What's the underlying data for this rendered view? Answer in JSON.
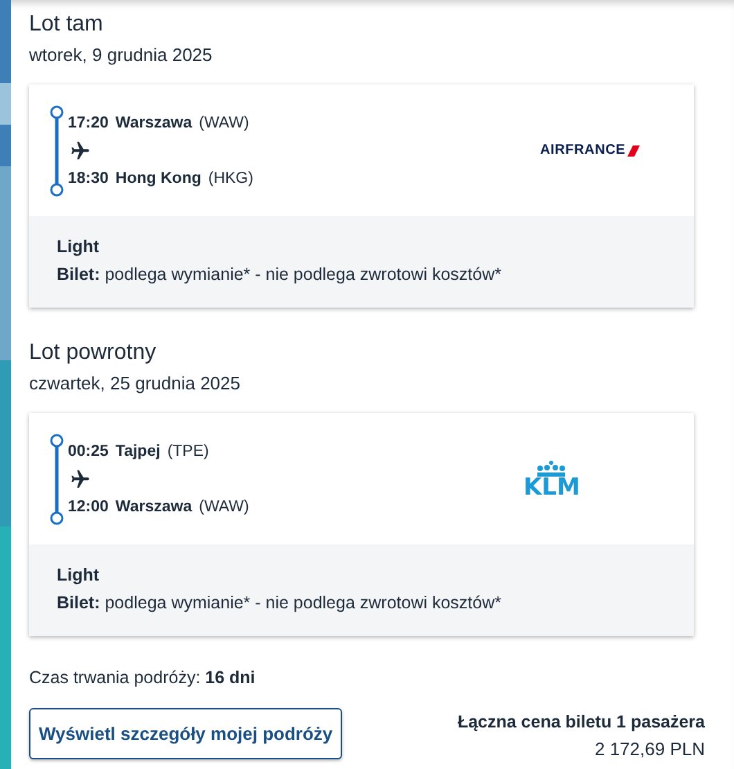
{
  "flights": [
    {
      "title": "Lot tam",
      "date": "wtorek, 9 grudnia 2025",
      "departure": {
        "time": "17:20",
        "city": "Warszawa",
        "code": "(WAW)"
      },
      "arrival": {
        "time": "18:30",
        "city": "Hong Kong",
        "code": "(HKG)"
      },
      "airline": {
        "kind": "airfrance",
        "logo_text": "AIRFRANCE"
      },
      "fare": "Light",
      "ticket_label": "Bilet:",
      "ticket_text": "podlega wymianie* - nie podlega zwrotowi kosztów*"
    },
    {
      "title": "Lot powrotny",
      "date": "czwartek, 25 grudnia 2025",
      "departure": {
        "time": "00:25",
        "city": "Tajpej",
        "code": "(TPE)"
      },
      "arrival": {
        "time": "12:00",
        "city": "Warszawa",
        "code": "(WAW)"
      },
      "airline": {
        "kind": "klm",
        "logo_text": "KLM"
      },
      "fare": "Light",
      "ticket_label": "Bilet:",
      "ticket_text": "podlega wymianie* - nie podlega zwrotowi kosztów*"
    }
  ],
  "duration": "Czas trwania podróży: **16 dni**",
  "details_button": "Wyświetl szczegóły mojej podróży",
  "price_label": "Łączna cena biletu 1 pasażera",
  "price": "2 172,69 PLN"
}
